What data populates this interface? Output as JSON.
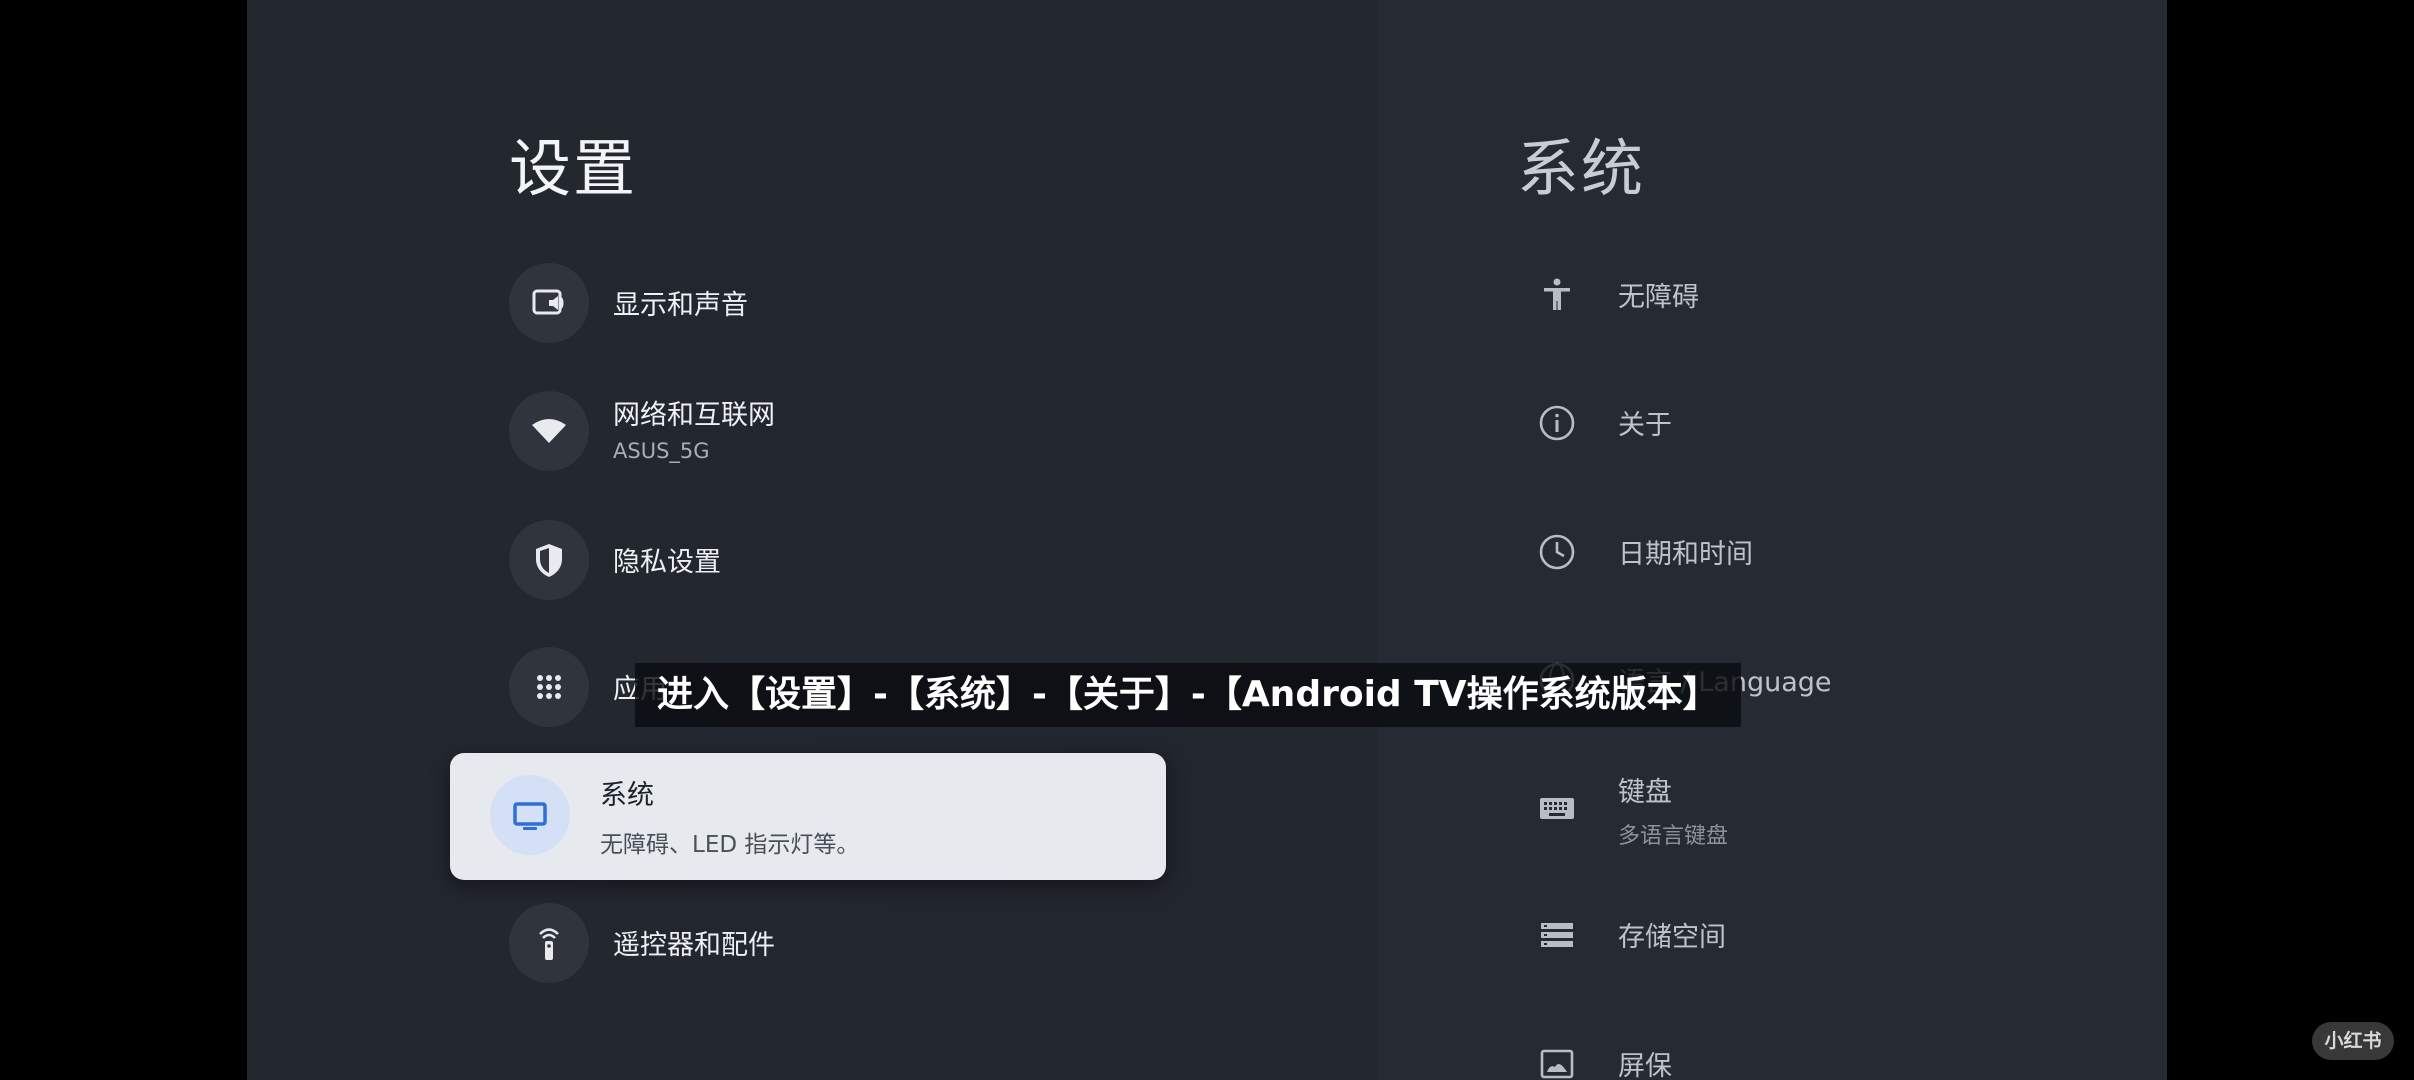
{
  "settings": {
    "title": "设置",
    "items": [
      {
        "label": "显示和声音",
        "sub": "",
        "icon": "display-sound-icon"
      },
      {
        "label": "网络和互联网",
        "sub": "ASUS_5G",
        "icon": "wifi-icon"
      },
      {
        "label": "隐私设置",
        "sub": "",
        "icon": "shield-icon"
      },
      {
        "label": "应用",
        "sub": "",
        "icon": "apps-grid-icon"
      },
      {
        "label": "系统",
        "sub": "无障碍、LED 指示灯等。",
        "icon": "tv-icon"
      },
      {
        "label": "遥控器和配件",
        "sub": "",
        "icon": "remote-icon"
      }
    ],
    "selected_index": 4
  },
  "system": {
    "title": "系统",
    "items": [
      {
        "label": "无障碍",
        "sub": "",
        "icon": "accessibility-icon"
      },
      {
        "label": "关于",
        "sub": "",
        "icon": "info-icon"
      },
      {
        "label": "日期和时间",
        "sub": "",
        "icon": "clock-icon"
      },
      {
        "label": "语言 / Language",
        "sub": "",
        "icon": "language-icon"
      },
      {
        "label": "键盘",
        "sub": "多语言键盘",
        "icon": "keyboard-icon"
      },
      {
        "label": "存储空间",
        "sub": "",
        "icon": "storage-icon"
      },
      {
        "label": "屏保",
        "sub": "",
        "icon": "screensaver-icon"
      }
    ]
  },
  "caption": "进入【设置】-【系统】-【关于】-【Android TV操作系统版本】",
  "watermark": "小红书",
  "colors": {
    "background": "#22262e",
    "selected_card": "#e6e9ee",
    "accent_blue": "#2f6fd6"
  }
}
